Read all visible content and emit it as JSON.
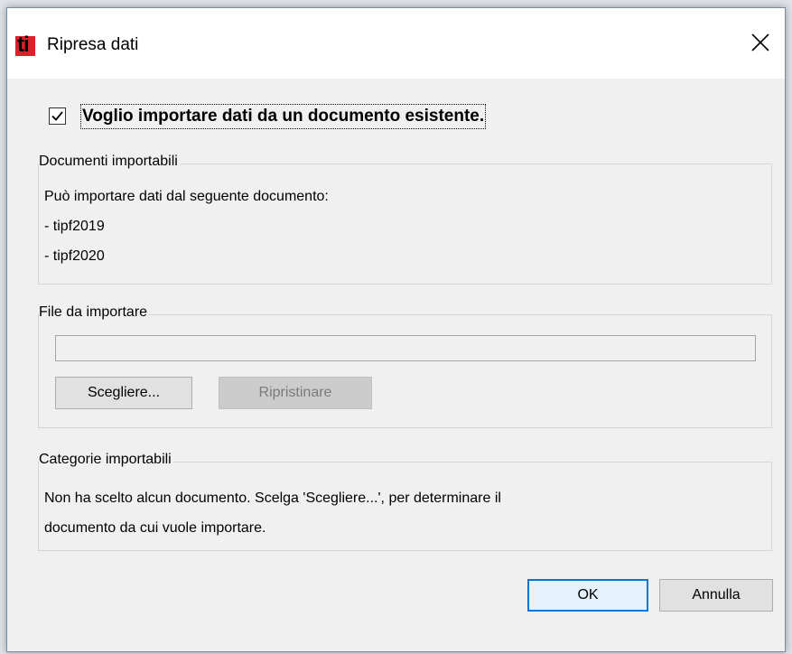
{
  "dialog": {
    "title": "Ripresa dati",
    "logo_text": "ti",
    "close_glyph": "close-icon"
  },
  "import_checkbox": {
    "label": "Voglio importare dati da un documento esistente.",
    "checked": true
  },
  "importable_documents": {
    "legend": "Documenti importabili",
    "description": "Può importare dati dal seguente documento:",
    "items": [
      "- tipf2019",
      "- tipf2020"
    ]
  },
  "file_to_import": {
    "legend": "File da importare",
    "path_value": "",
    "choose_label": "Scegliere...",
    "reset_label": "Ripristinare"
  },
  "importable_categories": {
    "legend": "Categorie importabili",
    "message_line1": "Non ha scelto alcun documento. Scelga 'Scegliere...', per determinare il",
    "message_line2": "documento da cui vuole importare."
  },
  "footer": {
    "ok_label": "OK",
    "cancel_label": "Annulla"
  },
  "colors": {
    "logo_red": "#d8232a",
    "default_button_border": "#0078d7",
    "dialog_background": "#f0f0f0"
  }
}
